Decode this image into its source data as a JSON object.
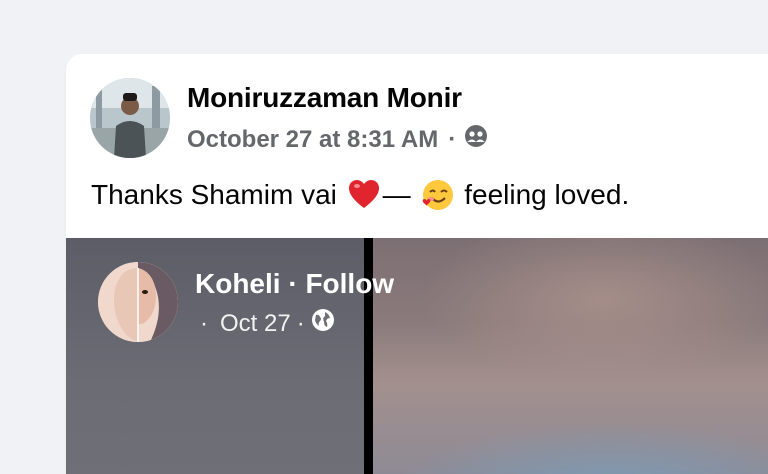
{
  "post": {
    "author": "Moniruzzaman Monir",
    "date": "October 27 at 8:31 AM",
    "separator": "·",
    "audience_icon": "friends-audience-icon",
    "text_before": "Thanks Shamim vai",
    "heart_emoji": "red-heart-emoji",
    "dash": "—",
    "feeling_emoji": "smiling-face-with-hearts-emoji",
    "text_after": "feeling loved."
  },
  "shared_story": {
    "name": "Koheli · Follow",
    "lead_separator": "·",
    "date": "Oct 27",
    "separator": "·",
    "audience_icon": "globe-icon"
  }
}
